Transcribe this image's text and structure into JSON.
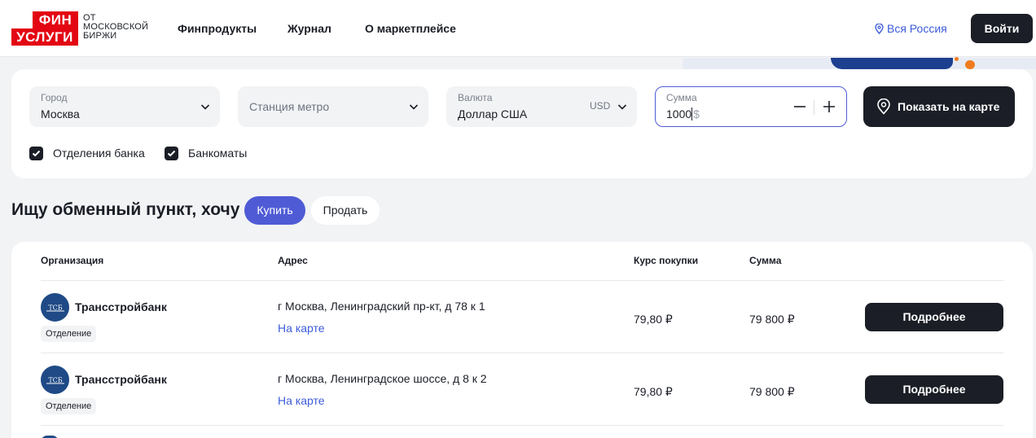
{
  "header": {
    "logo_top": "ФИН",
    "logo_bottom": "УСЛУГИ",
    "logo_sub": [
      "ОТ",
      "МОСКОВСКОЙ",
      "БИРЖИ"
    ],
    "nav": [
      "Финпродукты",
      "Журнал",
      "О маркетплейсе"
    ],
    "region": "Вся Россия",
    "login": "Войти"
  },
  "filters": {
    "city": {
      "label": "Город",
      "value": "Москва"
    },
    "metro": {
      "placeholder": "Станция метро"
    },
    "currency": {
      "label": "Валюта",
      "value": "Доллар США",
      "code": "USD"
    },
    "amount": {
      "label": "Сумма",
      "value": "1000",
      "currency": "$"
    },
    "map_button": "Показать на карте",
    "checkboxes": [
      {
        "label": "Отделения банка",
        "checked": true
      },
      {
        "label": "Банкоматы",
        "checked": true
      }
    ]
  },
  "search": {
    "heading": "Ищу обменный пункт, хочу",
    "buy": "Купить",
    "sell": "Продать"
  },
  "table": {
    "headers": [
      "Организация",
      "Адрес",
      "Курс покупки",
      "Сумма"
    ],
    "rows": [
      {
        "bank": "Трансстройбанк",
        "type": "Отделение",
        "address": "г Москва, Ленинградский пр-кт, д 78 к 1",
        "map_link": "На карте",
        "rate": "79,80 ₽",
        "sum": "79 800 ₽",
        "button": "Подробнее"
      },
      {
        "bank": "Трансстройбанк",
        "type": "Отделение",
        "address": "г Москва, Ленинградское шоссе, д 8 к 2",
        "map_link": "На карте",
        "rate": "79,80 ₽",
        "sum": "79 800 ₽",
        "button": "Подробнее"
      }
    ]
  },
  "colors": {
    "accent": "#4f5bd5",
    "link": "#3d5bd9",
    "dark": "#1b1e26",
    "brand_red": "#e30613",
    "bank_logo": "#1f4a86"
  },
  "icons": {
    "region": "map-pin-icon",
    "map_button": "map-pin-icon",
    "dropdown": "chevron-down-icon",
    "checkbox": "check-icon",
    "minus": "minus-icon",
    "plus": "plus-icon"
  }
}
